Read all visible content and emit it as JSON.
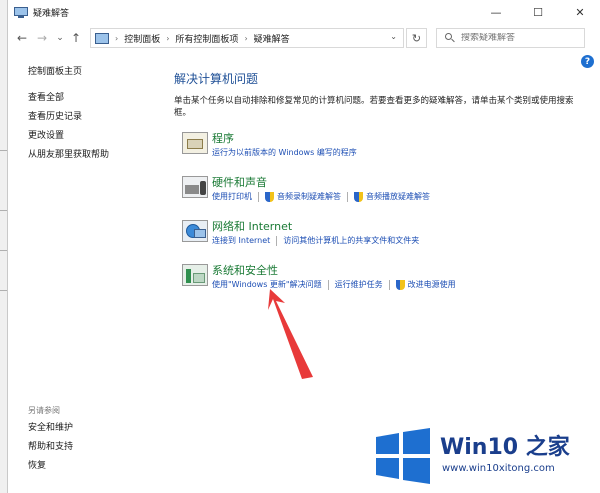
{
  "window": {
    "title": "疑难解答",
    "controls": {
      "minimize": "—",
      "maximize": "☐",
      "close": "✕"
    }
  },
  "nav": {
    "back": "←",
    "forward": "→",
    "recent": "⌄",
    "up": "↑",
    "breadcrumbs": [
      "控制面板",
      "所有控制面板项",
      "疑难解答"
    ],
    "breadcrumb_sep": "›",
    "dropdown": "⌄",
    "refresh": "↻",
    "search_placeholder": "搜索疑难解答"
  },
  "help": "?",
  "left_pane": {
    "home": "控制面板主页",
    "links": [
      "查看全部",
      "查看历史记录",
      "更改设置",
      "从朋友那里获取帮助"
    ],
    "see_also_heading": "另请参阅",
    "see_also": [
      "安全和维护",
      "帮助和支持",
      "恢复"
    ]
  },
  "main": {
    "title": "解决计算机问题",
    "description": "单击某个任务以自动排除和修复常见的计算机问题。若要查看更多的疑难解答，请单击某个类别或使用搜索框。"
  },
  "categories": [
    {
      "title": "程序",
      "icon": "programs-icon",
      "links": [
        {
          "text": "运行为以前版本的 Windows 编写的程序",
          "shield": false
        }
      ]
    },
    {
      "title": "硬件和声音",
      "icon": "hardware-sound-icon",
      "links": [
        {
          "text": "使用打印机",
          "shield": false
        },
        {
          "text": "音频录制疑难解答",
          "shield": true
        },
        {
          "text": "音频播放疑难解答",
          "shield": true
        }
      ]
    },
    {
      "title": "网络和 Internet",
      "icon": "network-icon",
      "links": [
        {
          "text": "连接到 Internet",
          "shield": false
        },
        {
          "text": "访问其他计算机上的共享文件和文件夹",
          "shield": false
        }
      ]
    },
    {
      "title": "系统和安全性",
      "icon": "system-security-icon",
      "links": [
        {
          "text": "使用\"Windows 更新\"解决问题",
          "shield": false
        },
        {
          "text": "运行维护任务",
          "shield": false
        },
        {
          "text": "改进电源使用",
          "shield": true
        }
      ]
    }
  ],
  "watermark": {
    "name": "Win10 之家",
    "url": "www.win10xitong.com"
  },
  "colors": {
    "link": "#1e4fb4",
    "category_title": "#1a7a35",
    "heading": "#1e4f96",
    "arrow": "#e83a3a",
    "watermark": "#1a3e8c"
  }
}
